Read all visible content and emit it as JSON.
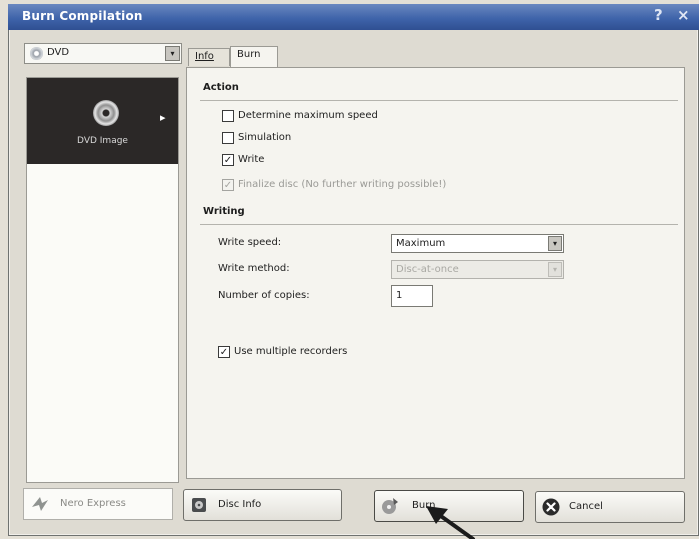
{
  "window": {
    "title": "Burn Compilation",
    "help_glyph": "?",
    "close_glyph": "×"
  },
  "left": {
    "combo_value": "DVD",
    "combo_arrow": "▾",
    "tile_label": "DVD Image",
    "tile_arrow": "▸"
  },
  "tabs": [
    {
      "label": "Info",
      "selected": false
    },
    {
      "label": "Burn",
      "selected": true
    }
  ],
  "action": {
    "heading": "Action",
    "options": [
      {
        "label": "Determine maximum speed",
        "checked": false,
        "enabled": true
      },
      {
        "label": "Simulation",
        "checked": false,
        "enabled": true
      },
      {
        "label": "Write",
        "checked": true,
        "enabled": true
      },
      {
        "label": "Finalize disc (No further writing possible!)",
        "checked": true,
        "enabled": false
      }
    ]
  },
  "writing": {
    "heading": "Writing",
    "write_speed_label": "Write speed:",
    "write_speed_value": "Maximum",
    "write_method_label": "Write method:",
    "write_method_value": "Disc-at-once",
    "copies_label": "Number of copies:",
    "copies_value": "1",
    "multi_recorders_label": "Use multiple recorders",
    "multi_recorders_checked": true
  },
  "buttons": {
    "nero_express": "Nero Express",
    "disc_info": "Disc Info",
    "burn": "Burn",
    "cancel": "Cancel"
  },
  "colors": {
    "titlebar": "#3f64aa",
    "window_bg": "#dedbd2",
    "tile_bg": "#2b2827"
  },
  "icons": {
    "check": "✓",
    "dropdown": "▾"
  }
}
